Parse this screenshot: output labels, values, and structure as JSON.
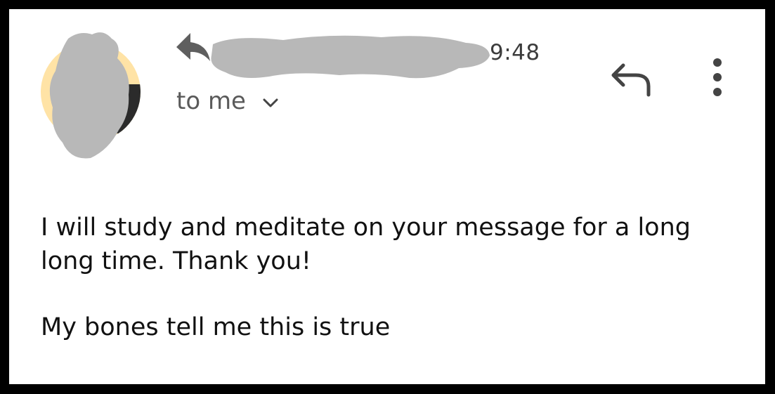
{
  "email": {
    "time": "9:48",
    "recipient_label": "to me",
    "body": {
      "line1": "I will study and meditate on your message for a long",
      "line2": "long time. Thank you!",
      "line3": "My bones tell me this is true"
    }
  },
  "icons": {
    "sender_status": "reply-arrow-icon",
    "expand": "chevron-down-icon",
    "reply": "reply-icon",
    "more": "more-vertical-icon"
  },
  "colors": {
    "frame": "#000000",
    "background": "#ffffff",
    "redaction": "#b8b8b8",
    "avatar_ring": "#ffe3a6",
    "text": "#111111",
    "secondary_text": "#5a5a5a",
    "icon": "#444444"
  }
}
